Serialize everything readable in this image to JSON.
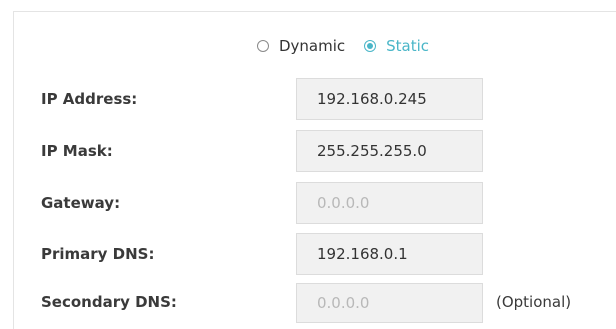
{
  "mode": {
    "options": [
      {
        "label": "Dynamic",
        "selected": false
      },
      {
        "label": "Static",
        "selected": true
      }
    ],
    "accent_color": "#4ab6c8"
  },
  "fields": [
    {
      "label": "IP Address:",
      "value": "192.168.0.245",
      "placeholder": ""
    },
    {
      "label": "IP Mask:",
      "value": "255.255.255.0",
      "placeholder": ""
    },
    {
      "label": "Gateway:",
      "value": "",
      "placeholder": "0.0.0.0"
    },
    {
      "label": "Primary DNS:",
      "value": "192.168.0.1",
      "placeholder": ""
    },
    {
      "label": "Secondary DNS:",
      "value": "",
      "placeholder": "0.0.0.0"
    }
  ],
  "secondary_dns_note": "(Optional)"
}
